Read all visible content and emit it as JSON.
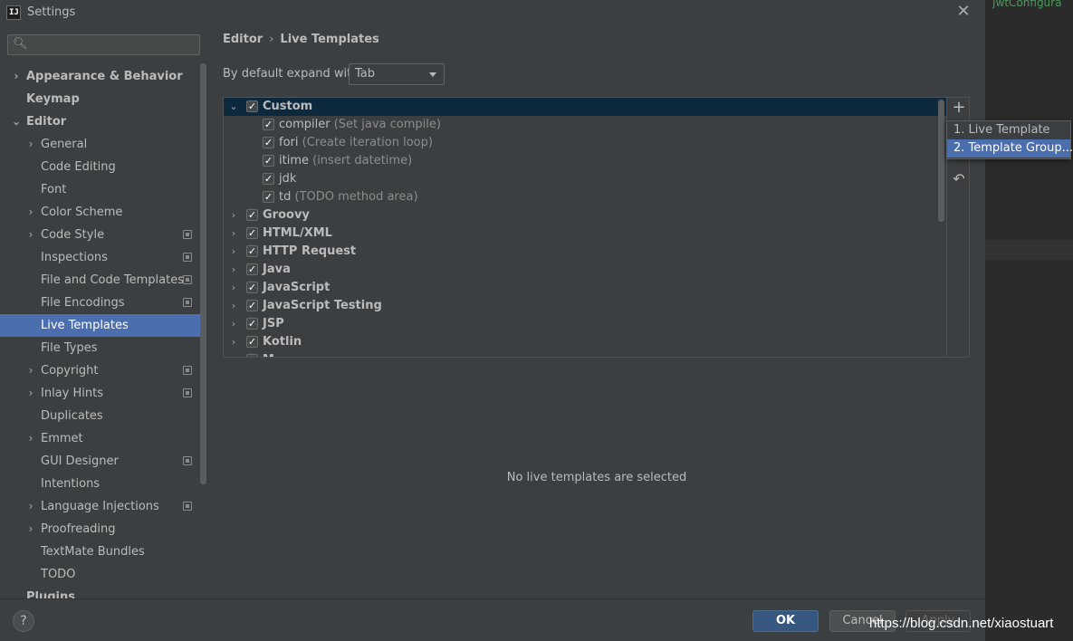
{
  "window": {
    "title": "Settings",
    "logo_text": "IJ"
  },
  "background_editor": {
    "tab_stub": "JwtConfigura"
  },
  "search": {
    "placeholder": "",
    "value": ""
  },
  "sidebar": {
    "items": [
      {
        "label": "Appearance & Behavior",
        "level": 0,
        "arrow": "›",
        "cfg": false,
        "selected": false
      },
      {
        "label": "Keymap",
        "level": 0,
        "arrow": "",
        "cfg": false,
        "selected": false
      },
      {
        "label": "Editor",
        "level": 0,
        "arrow": "⌄",
        "cfg": false,
        "selected": false
      },
      {
        "label": "General",
        "level": 1,
        "arrow": "›",
        "cfg": false,
        "selected": false
      },
      {
        "label": "Code Editing",
        "level": 1,
        "arrow": "",
        "cfg": false,
        "selected": false
      },
      {
        "label": "Font",
        "level": 1,
        "arrow": "",
        "cfg": false,
        "selected": false
      },
      {
        "label": "Color Scheme",
        "level": 1,
        "arrow": "›",
        "cfg": false,
        "selected": false
      },
      {
        "label": "Code Style",
        "level": 1,
        "arrow": "›",
        "cfg": true,
        "selected": false
      },
      {
        "label": "Inspections",
        "level": 1,
        "arrow": "",
        "cfg": true,
        "selected": false
      },
      {
        "label": "File and Code Templates",
        "level": 1,
        "arrow": "",
        "cfg": true,
        "selected": false
      },
      {
        "label": "File Encodings",
        "level": 1,
        "arrow": "",
        "cfg": true,
        "selected": false
      },
      {
        "label": "Live Templates",
        "level": 1,
        "arrow": "",
        "cfg": false,
        "selected": true
      },
      {
        "label": "File Types",
        "level": 1,
        "arrow": "",
        "cfg": false,
        "selected": false
      },
      {
        "label": "Copyright",
        "level": 1,
        "arrow": "›",
        "cfg": true,
        "selected": false
      },
      {
        "label": "Inlay Hints",
        "level": 1,
        "arrow": "›",
        "cfg": true,
        "selected": false
      },
      {
        "label": "Duplicates",
        "level": 1,
        "arrow": "",
        "cfg": false,
        "selected": false
      },
      {
        "label": "Emmet",
        "level": 1,
        "arrow": "›",
        "cfg": false,
        "selected": false
      },
      {
        "label": "GUI Designer",
        "level": 1,
        "arrow": "",
        "cfg": true,
        "selected": false
      },
      {
        "label": "Intentions",
        "level": 1,
        "arrow": "",
        "cfg": false,
        "selected": false
      },
      {
        "label": "Language Injections",
        "level": 1,
        "arrow": "›",
        "cfg": true,
        "selected": false
      },
      {
        "label": "Proofreading",
        "level": 1,
        "arrow": "›",
        "cfg": false,
        "selected": false
      },
      {
        "label": "TextMate Bundles",
        "level": 1,
        "arrow": "",
        "cfg": false,
        "selected": false
      },
      {
        "label": "TODO",
        "level": 1,
        "arrow": "",
        "cfg": false,
        "selected": false
      },
      {
        "label": "Plugins",
        "level": 0,
        "arrow": "",
        "cfg": false,
        "selected": false
      }
    ]
  },
  "breadcrumb": {
    "parent": "Editor",
    "separator": "›",
    "current": "Live Templates"
  },
  "expand": {
    "label": "By default expand with",
    "value": "Tab"
  },
  "tree": {
    "rows": [
      {
        "type": "group",
        "name": "Custom",
        "desc": "",
        "expanded": true,
        "checked": true,
        "selected": true
      },
      {
        "type": "item",
        "name": "compiler",
        "desc": "(Set java compile)",
        "checked": true
      },
      {
        "type": "item",
        "name": "fori",
        "desc": "(Create iteration loop)",
        "checked": true
      },
      {
        "type": "item",
        "name": "itime",
        "desc": "(insert datetime)",
        "checked": true
      },
      {
        "type": "item",
        "name": "jdk",
        "desc": "",
        "checked": true
      },
      {
        "type": "item",
        "name": "td",
        "desc": "(TODO method area)",
        "checked": true
      },
      {
        "type": "group",
        "name": "Groovy",
        "desc": "",
        "expanded": false,
        "checked": true,
        "selected": false
      },
      {
        "type": "group",
        "name": "HTML/XML",
        "desc": "",
        "expanded": false,
        "checked": true,
        "selected": false
      },
      {
        "type": "group",
        "name": "HTTP Request",
        "desc": "",
        "expanded": false,
        "checked": true,
        "selected": false
      },
      {
        "type": "group",
        "name": "Java",
        "desc": "",
        "expanded": false,
        "checked": true,
        "selected": false
      },
      {
        "type": "group",
        "name": "JavaScript",
        "desc": "",
        "expanded": false,
        "checked": true,
        "selected": false
      },
      {
        "type": "group",
        "name": "JavaScript Testing",
        "desc": "",
        "expanded": false,
        "checked": true,
        "selected": false
      },
      {
        "type": "group",
        "name": "JSP",
        "desc": "",
        "expanded": false,
        "checked": true,
        "selected": false
      },
      {
        "type": "group",
        "name": "Kotlin",
        "desc": "",
        "expanded": false,
        "checked": true,
        "selected": false
      },
      {
        "type": "group",
        "name": "M",
        "desc": "",
        "expanded": false,
        "checked": true,
        "selected": false
      }
    ]
  },
  "popup": {
    "items": [
      {
        "label": "1. Live Template",
        "selected": false
      },
      {
        "label": "2. Template Group...",
        "selected": true
      }
    ]
  },
  "empty_message": "No live templates are selected",
  "buttons": {
    "help": "?",
    "ok": "OK",
    "cancel": "Cancel",
    "apply": "Apply",
    "add": "+",
    "undo": "↶",
    "close": "✕"
  },
  "watermark": "https://blog.csdn.net/xiaostuart",
  "icons": {
    "search": "search-icon",
    "close": "close-icon",
    "add": "plus-icon",
    "undo": "undo-icon",
    "config": "project-config-icon"
  },
  "colors": {
    "selection": "#4b6eaf",
    "tree_selection": "#0d293e",
    "ok_button": "#365880",
    "panel": "#3c3f41"
  }
}
